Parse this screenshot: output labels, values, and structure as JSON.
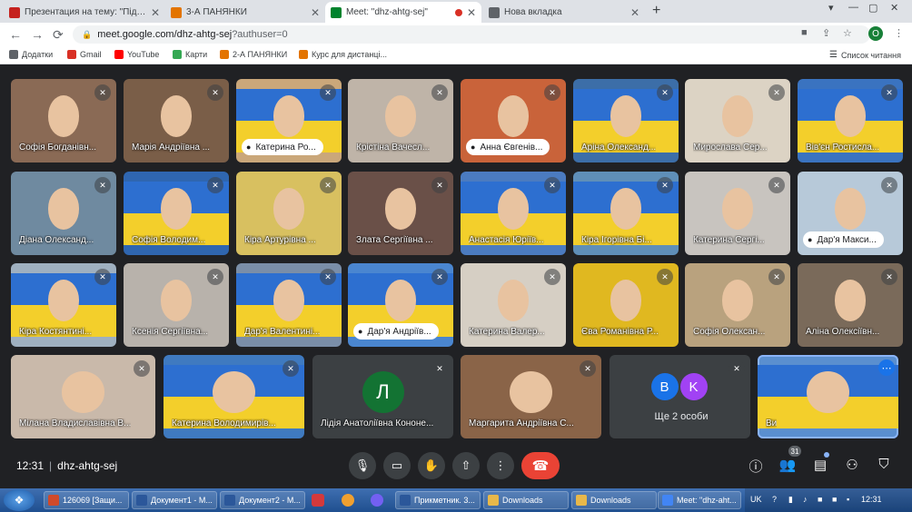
{
  "browser": {
    "tabs": [
      {
        "title": "Презентация на тему: \"Підготу",
        "icon_color": "#c5221f",
        "active": false
      },
      {
        "title": "3-А ПАНЯНКИ",
        "icon_color": "#e37400",
        "active": false
      },
      {
        "title": "Meet: \"dhz-ahtg-sej\"",
        "icon_color": "#00832d",
        "active": true
      },
      {
        "title": "Нова вкладка",
        "icon_color": "#5f6368",
        "active": false
      }
    ],
    "new_tab_glyph": "+",
    "close_glyph": "✕",
    "url": "meet.google.com/dhz-ahtg-sej",
    "url_suffix": "?authuser=0",
    "profile_initial": "O"
  },
  "bookmarks": [
    {
      "label": "Додатки",
      "icon_color": "#5f6368"
    },
    {
      "label": "Gmail",
      "icon_color": "#d93025"
    },
    {
      "label": "YouTube",
      "icon_color": "#ff0000"
    },
    {
      "label": "Карти",
      "icon_color": "#34a853"
    },
    {
      "label": "2-А ПАНЯНКИ",
      "icon_color": "#e37400"
    },
    {
      "label": "Курс для дистанці...",
      "icon_color": "#e37400"
    }
  ],
  "reading_list": "Список читання",
  "meet": {
    "tiles": [
      {
        "name": "Софія Богданівн...",
        "pill": false,
        "bg": "#8a6a55",
        "flag": false
      },
      {
        "name": "Марія Андріївна ...",
        "pill": false,
        "bg": "#7a5e48",
        "flag": false
      },
      {
        "name": "Катерина Ро...",
        "pill": true,
        "bg": "#caa77a",
        "flag": true
      },
      {
        "name": "Крістіна Вачесл...",
        "pill": false,
        "bg": "#bfb4a8",
        "flag": false
      },
      {
        "name": "Анна Євгенів...",
        "pill": true,
        "bg": "#c9633a",
        "flag": false
      },
      {
        "name": "Аріна Олександ...",
        "pill": false,
        "bg": "#3c6ea8",
        "flag": true
      },
      {
        "name": "Мирослава Сер...",
        "pill": false,
        "bg": "#dcd3c4",
        "flag": false
      },
      {
        "name": "Вів'єн Ростисла...",
        "pill": false,
        "bg": "#3a73c0",
        "flag": true
      },
      {
        "name": "Діана Олександ...",
        "pill": false,
        "bg": "#6f8aa0",
        "flag": false
      },
      {
        "name": "Софія Володим...",
        "pill": false,
        "bg": "#2f66b0",
        "flag": true
      },
      {
        "name": "Кіра Артурівна ...",
        "pill": false,
        "bg": "#d8c060",
        "flag": false
      },
      {
        "name": "Злата Сергіївна ...",
        "pill": false,
        "bg": "#6a5048",
        "flag": false
      },
      {
        "name": "Анастасія Юріїв...",
        "pill": false,
        "bg": "#4b7bc0",
        "flag": true
      },
      {
        "name": "Кіра Ігорівна Бі...",
        "pill": false,
        "bg": "#5f8fb8",
        "flag": true
      },
      {
        "name": "Катерина Сергі...",
        "pill": false,
        "bg": "#c8c4bf",
        "flag": false
      },
      {
        "name": "Дар'я Макси...",
        "pill": true,
        "bg": "#b7c9d9",
        "flag": false
      },
      {
        "name": "Кіра Костянтині...",
        "pill": false,
        "bg": "#9fb0c0",
        "flag": true
      },
      {
        "name": "Ксенія Сергіївна...",
        "pill": false,
        "bg": "#b8b2ab",
        "flag": false
      },
      {
        "name": "Дар'я Валентині...",
        "pill": false,
        "bg": "#7a8ea8",
        "flag": true
      },
      {
        "name": "Дар'я Андріїв...",
        "pill": true,
        "bg": "#4a86d0",
        "flag": true
      },
      {
        "name": "Катерина Валер...",
        "pill": false,
        "bg": "#d6cfc4",
        "flag": false
      },
      {
        "name": "Єва Романівна Р...",
        "pill": false,
        "bg": "#e0b820",
        "flag": false
      },
      {
        "name": "Софія Олексан...",
        "pill": false,
        "bg": "#b9a27e",
        "flag": false
      },
      {
        "name": "Аліна Олексіївн...",
        "pill": false,
        "bg": "#7a6a5a",
        "flag": false
      },
      {
        "name": "Мілана Владиславівна В...",
        "pill": false,
        "bg": "#c9b9aa",
        "flag": false
      },
      {
        "name": "Катерина Володимирів...",
        "pill": false,
        "bg": "#3f7ac0",
        "flag": true
      },
      {
        "name": "Лідія Анатоліївна Кононе...",
        "pill": false,
        "bg": "#3c4043",
        "flag": false,
        "avatar": "Л",
        "avatar_color": "#137333"
      },
      {
        "name": "Маргарита Андріївна С...",
        "pill": false,
        "bg": "#8a6448",
        "flag": false
      },
      {
        "name": "",
        "pill": false,
        "bg": "#3c4043",
        "flag": false,
        "others": "Ще 2 особи",
        "small_avatars": [
          {
            "letter": "B",
            "color": "#1a73e8"
          },
          {
            "letter": "K",
            "color": "#a142f4"
          }
        ]
      },
      {
        "name": "Ви",
        "pill": false,
        "bg": "#5a8fcf",
        "flag": true,
        "self": true
      }
    ],
    "time": "12:31",
    "meeting_code": "dhz-ahtg-sej",
    "participants_count": "31"
  },
  "taskbar": {
    "items": [
      {
        "label": "126069 [Защи...",
        "icon_color": "#d04a2a"
      },
      {
        "label": "Документ1 - М...",
        "icon_color": "#2b579a"
      },
      {
        "label": "Документ2 - М...",
        "icon_color": "#2b579a"
      },
      {
        "label": "Прикметник. 3...",
        "icon_color": "#2b579a"
      },
      {
        "label": "Downloads",
        "icon_color": "#e8b84a"
      },
      {
        "label": "Downloads",
        "icon_color": "#e8b84a"
      },
      {
        "label": "Meet: \"dhz-aht...",
        "icon_color": "#4285f4"
      }
    ],
    "lang": "UK",
    "clock": "12:31"
  }
}
